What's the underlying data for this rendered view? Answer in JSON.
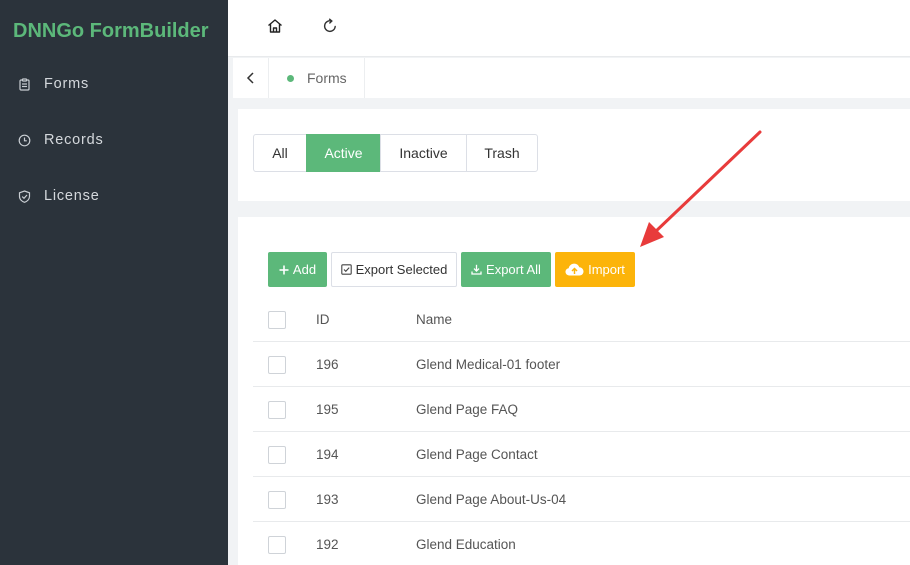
{
  "app": {
    "title": "DNNGo FormBuilder",
    "accent": "#5cb87a",
    "warning": "#fcb40a",
    "sidebar_bg": "#2b333b"
  },
  "sidebar": {
    "items": [
      {
        "label": "Forms",
        "icon": "clipboard-icon"
      },
      {
        "label": "Records",
        "icon": "clock-icon"
      },
      {
        "label": "License",
        "icon": "shield-check-icon"
      }
    ]
  },
  "topbar": {
    "icons": [
      "home-icon",
      "refresh-icon"
    ]
  },
  "tabs": {
    "current": "Forms"
  },
  "filters": [
    "All",
    "Active",
    "Inactive",
    "Trash"
  ],
  "filter_selected": "Active",
  "toolbar": {
    "add": "Add",
    "export_selected": "Export Selected",
    "export_all": "Export All",
    "import": "Import"
  },
  "table": {
    "headers": {
      "id": "ID",
      "name": "Name"
    },
    "rows": [
      {
        "id": "196",
        "name": "Glend Medical-01 footer"
      },
      {
        "id": "195",
        "name": "Glend Page FAQ"
      },
      {
        "id": "194",
        "name": "Glend Page Contact"
      },
      {
        "id": "193",
        "name": "Glend Page About-Us-04"
      },
      {
        "id": "192",
        "name": "Glend Education"
      }
    ]
  },
  "annotation": {
    "type": "arrow",
    "color": "#e83b3b",
    "points_to": "import-button"
  }
}
